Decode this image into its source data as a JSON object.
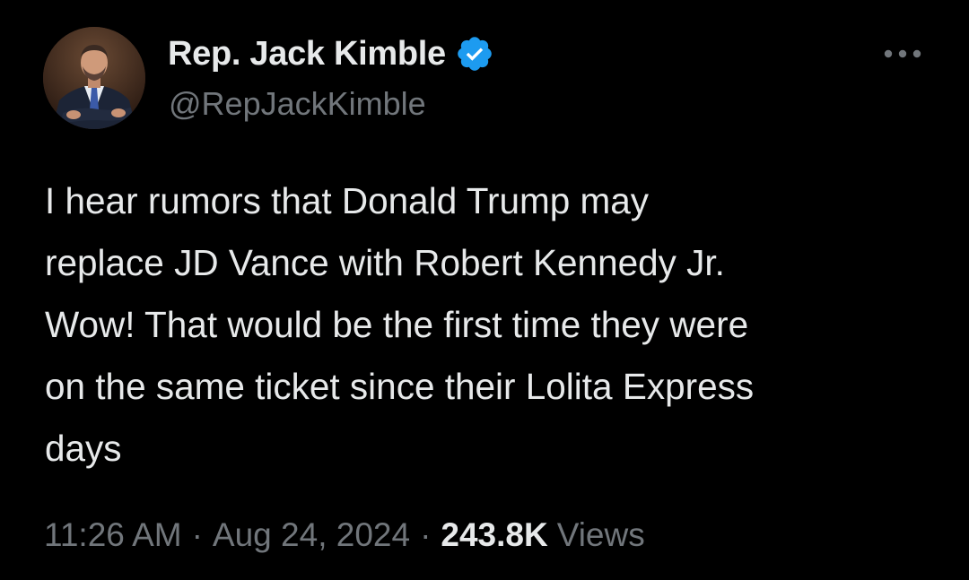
{
  "author": {
    "display_name": "Rep. Jack Kimble",
    "handle": "@RepJackKimble",
    "verified": true,
    "verified_color": "#1d9bf0",
    "avatar": "profile-photo"
  },
  "more_menu": {
    "icon": "more-horizontal-icon"
  },
  "tweet": {
    "text": "I hear rumors that Donald Trump may\nreplace JD Vance with Robert Kennedy Jr.\nWow! That would be the first time they were\non the same ticket since their Lolita Express\ndays"
  },
  "meta": {
    "time": "11:26 AM",
    "separator": "·",
    "date": "Aug 24, 2024",
    "views_count": "243.8K",
    "views_label": "Views"
  },
  "colors": {
    "background": "#000000",
    "primary_text": "#e7e9ea",
    "secondary_text": "#71767b"
  }
}
